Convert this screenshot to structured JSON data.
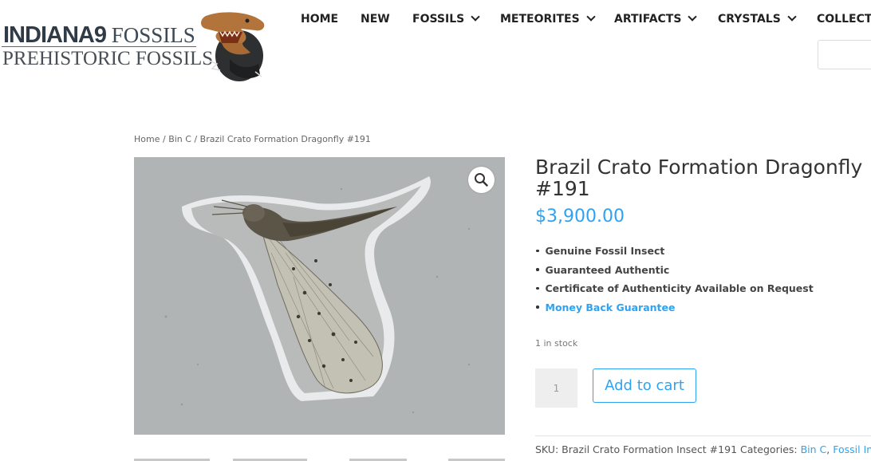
{
  "brand": {
    "line1_bold": "INDIANA9",
    "line1_rest": " FOSSILS",
    "line2": "PREHISTORIC FOSSILS"
  },
  "nav": {
    "items": [
      {
        "label": "HOME",
        "dropdown": false
      },
      {
        "label": "NEW",
        "dropdown": false
      },
      {
        "label": "FOSSILS",
        "dropdown": true
      },
      {
        "label": "METEORITES",
        "dropdown": true
      },
      {
        "label": "ARTIFACTS",
        "dropdown": true
      },
      {
        "label": "CRYSTALS",
        "dropdown": true
      },
      {
        "label": "COLLECTI",
        "dropdown": false
      }
    ]
  },
  "breadcrumb": {
    "home": "Home",
    "sep1": " / ",
    "category": "Bin C",
    "sep2": " / ",
    "current": "Brazil Crato Formation Dragonfly #191"
  },
  "product": {
    "title": "Brazil Crato Formation Dragonfly #191",
    "price": "$3,900.00",
    "features": [
      {
        "text": "Genuine Fossil Insect",
        "link": false
      },
      {
        "text": "Guaranteed Authentic",
        "link": false
      },
      {
        "text": "Certificate of Authenticity Available on Request",
        "link": false
      },
      {
        "text": "Money Back Guarantee",
        "link": true
      }
    ],
    "stock": "1 in stock",
    "quantity": "1",
    "add_to_cart_label": "Add to cart",
    "sku_label": "SKU:",
    "sku": "Brazil Crato Formation Insect #191",
    "categories_label": "Categories:",
    "categories": [
      "Bin C",
      "Fossil Insects"
    ],
    "categories_sep": ", "
  },
  "colors": {
    "accent": "#2ea3f2",
    "text": "#333333",
    "stone": "#b4b6b6"
  },
  "icons": {
    "zoom": "magnifier-icon",
    "dropdown": "chevron-down-icon",
    "logo": "t-rex-logo-icon"
  }
}
